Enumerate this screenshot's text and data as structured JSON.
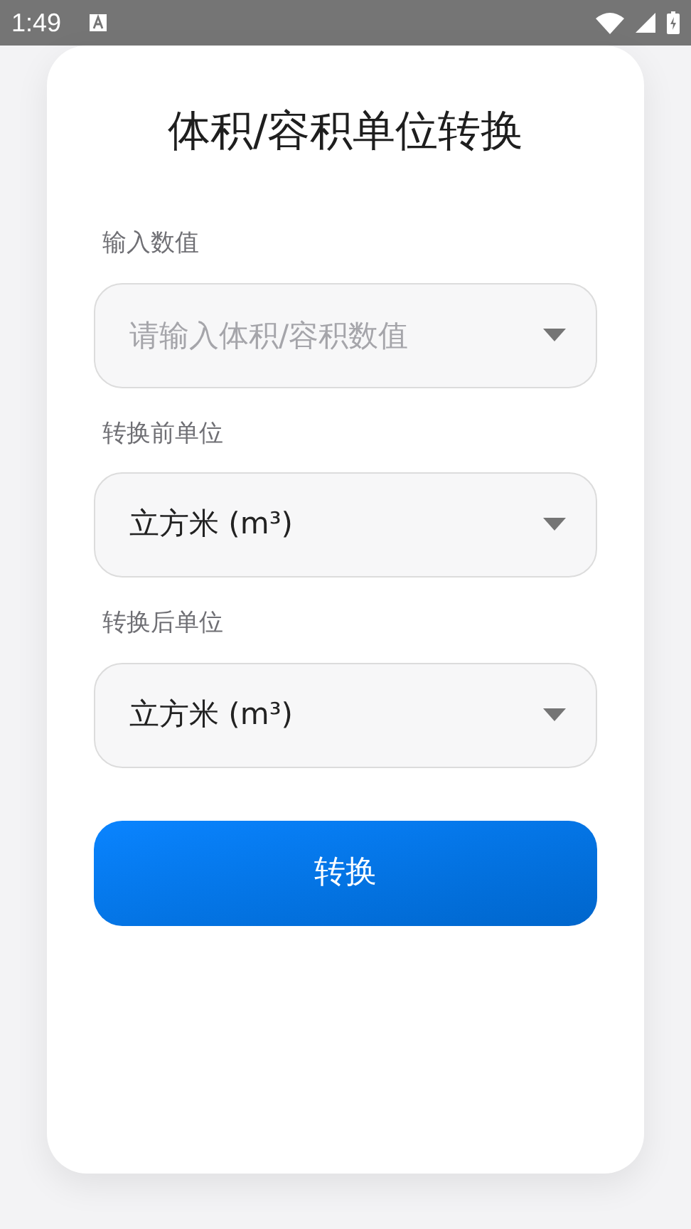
{
  "status_bar": {
    "time": "1:49"
  },
  "title": "体积/容积单位转换",
  "fields": [
    {
      "kind": "input",
      "label": "输入数值",
      "placeholder": "请输入体积/容积数值"
    },
    {
      "kind": "select",
      "label": "转换前单位",
      "value": "立方米 (m³)"
    },
    {
      "kind": "select",
      "label": "转换后单位",
      "value": "立方米 (m³)"
    }
  ],
  "button": "转换"
}
